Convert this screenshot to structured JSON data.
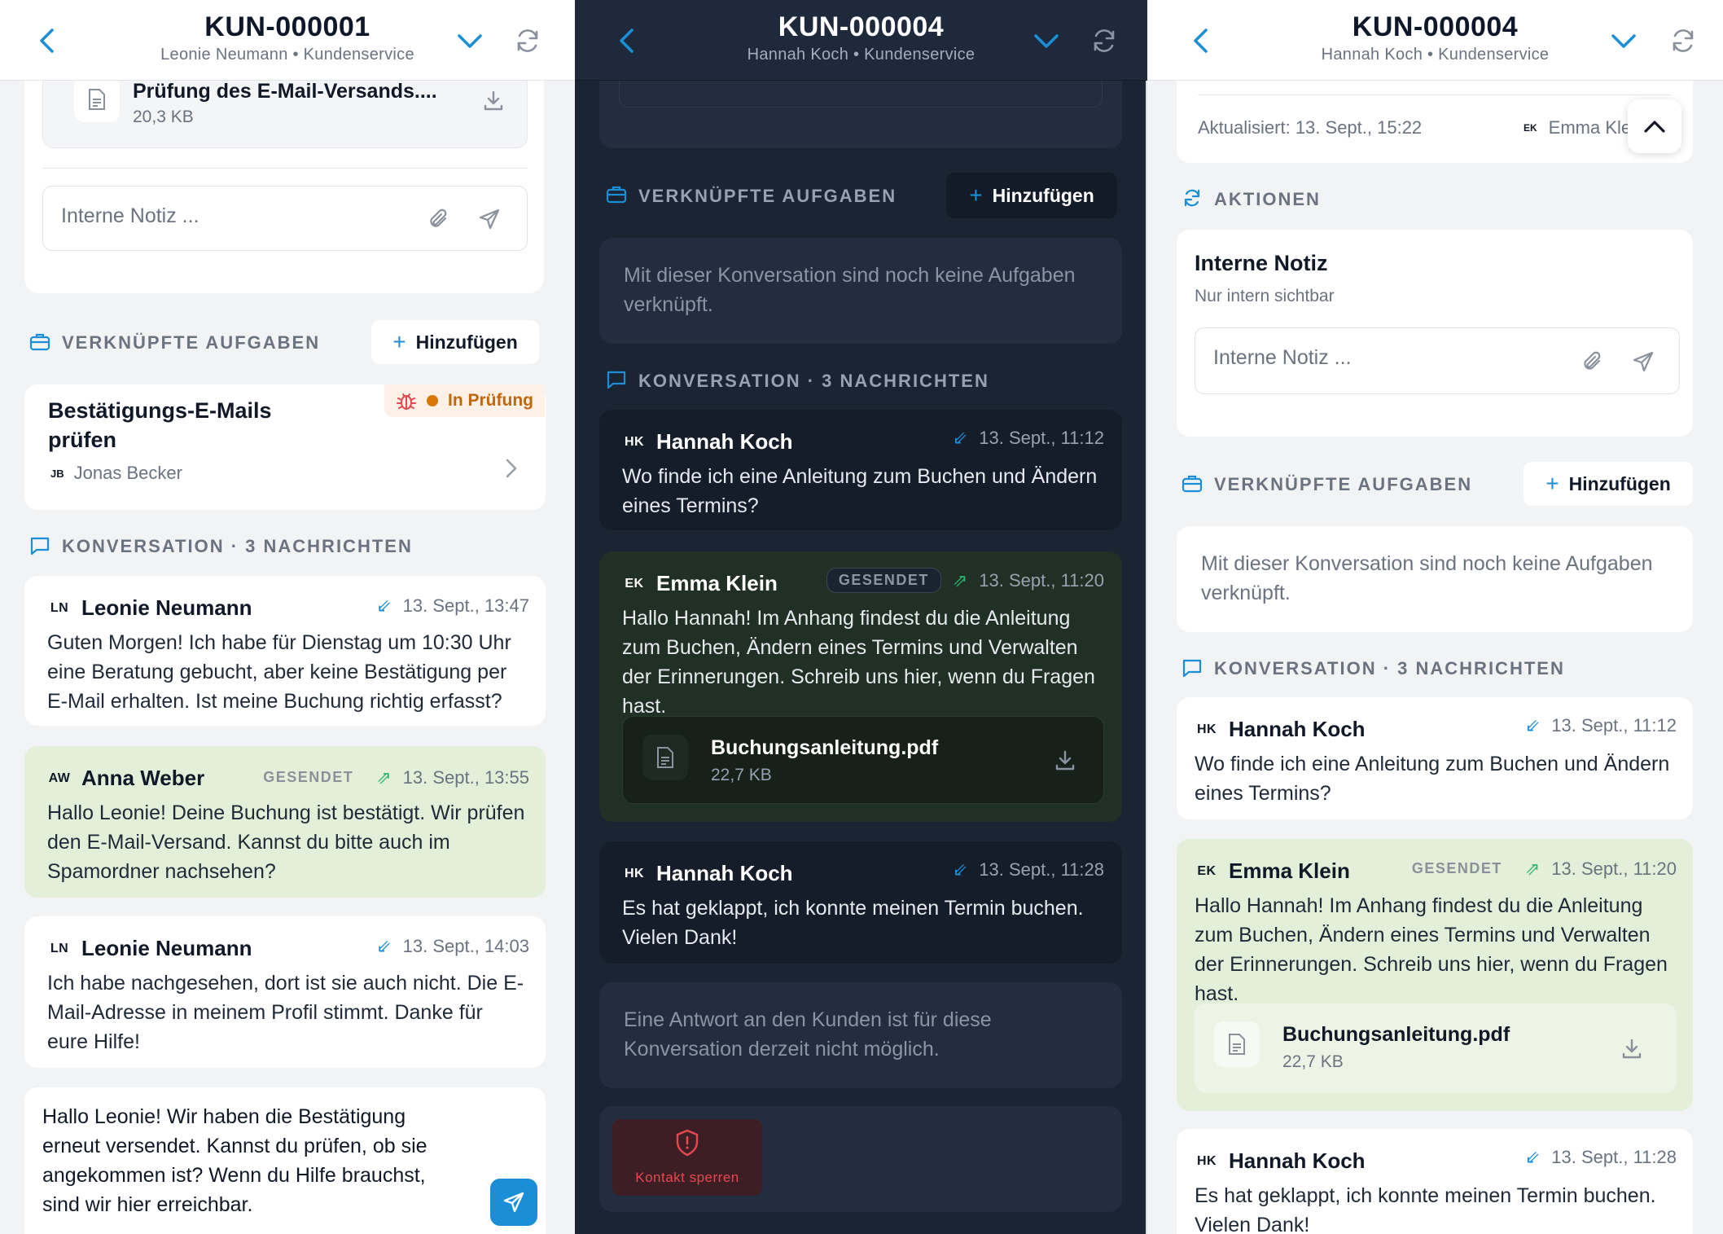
{
  "panel1": {
    "header": {
      "title": "KUN-000001",
      "subtitle": "Leonie Neumann • Kundenservice"
    },
    "attachment": {
      "name": "Prüfung des E-Mail-Versands....",
      "size": "20,3 KB"
    },
    "note_placeholder": "Interne Notiz ...",
    "tasks_section": {
      "label": "VERKNÜPFTE AUFGABEN",
      "add_label": "Hinzufügen"
    },
    "task": {
      "title": "Bestätigungs-E-Mails prüfen",
      "status": "In Prüfung",
      "assignee_initials": "JB",
      "assignee": "Jonas Becker"
    },
    "conversation_section": {
      "label": "KONVERSATION · 3 NACHRICHTEN"
    },
    "messages": [
      {
        "initials": "LN",
        "name": "Leonie Neumann",
        "time": "13. Sept., 13:47",
        "text": "Guten Morgen! Ich habe für Dienstag um 10:30 Uhr eine Beratung gebucht, aber keine Bestätigung per E-Mail erhalten. Ist meine Buchung richtig erfasst?"
      },
      {
        "initials": "AW",
        "name": "Anna Weber",
        "badge": "GESENDET",
        "time": "13. Sept., 13:55",
        "text": "Hallo Leonie! Deine Buchung ist bestätigt. Wir prüfen den E-Mail-Versand. Kannst du bitte auch im Spamordner nachsehen?"
      },
      {
        "initials": "LN",
        "name": "Leonie Neumann",
        "time": "13. Sept., 14:03",
        "text": "Ich habe nachgesehen, dort ist sie auch nicht. Die E-Mail-Adresse in meinem Profil stimmt. Danke für eure Hilfe!"
      }
    ],
    "reply_text": "Hallo Leonie! Wir haben die Bestätigung erneut versendet. Kannst du prüfen, ob sie angekommen ist? Wenn du Hilfe brauchst, sind wir hier erreichbar."
  },
  "panel2": {
    "header": {
      "title": "KUN-000004",
      "subtitle": "Hannah Koch • Kundenservice"
    },
    "tasks_section": {
      "label": "VERKNÜPFTE AUFGABEN",
      "add_label": "Hinzufügen"
    },
    "tasks_empty": "Mit dieser Konversation sind noch keine Aufgaben verknüpft.",
    "conversation_section": {
      "label": "KONVERSATION · 3 NACHRICHTEN"
    },
    "messages": [
      {
        "initials": "HK",
        "name": "Hannah Koch",
        "time": "13. Sept., 11:12",
        "text": "Wo finde ich eine Anleitung zum Buchen und Ändern eines Termins?"
      },
      {
        "initials": "EK",
        "name": "Emma Klein",
        "badge": "GESENDET",
        "time": "13. Sept., 11:20",
        "text": "Hallo Hannah! Im Anhang findest du die Anleitung zum Buchen, Ändern eines Termins und Verwalten der Erinnerungen. Schreib uns hier, wenn du Fragen hast.",
        "attachment": {
          "name": "Buchungsanleitung.pdf",
          "size": "22,7 KB"
        }
      },
      {
        "initials": "HK",
        "name": "Hannah Koch",
        "time": "13. Sept., 11:28",
        "text": "Es hat geklappt, ich konnte meinen Termin buchen. Vielen Dank!"
      }
    ],
    "reply_disabled": "Eine Antwort an den Kunden ist für diese Konversation derzeit nicht möglich.",
    "block_label": "Kontakt sperren"
  },
  "panel3": {
    "header": {
      "title": "KUN-000004",
      "subtitle": "Hannah Koch • Kundenservice"
    },
    "updated": "Aktualisiert: 13. Sept., 15:22",
    "updated_by_initials": "EK",
    "updated_by": "Emma Klein",
    "actions_section": {
      "label": "AKTIONEN"
    },
    "internal_note": {
      "title": "Interne Notiz",
      "subtitle": "Nur intern sichtbar",
      "placeholder": "Interne Notiz ..."
    },
    "tasks_section": {
      "label": "VERKNÜPFTE AUFGABEN",
      "add_label": "Hinzufügen"
    },
    "tasks_empty": "Mit dieser Konversation sind noch keine Aufgaben verknüpft.",
    "conversation_section": {
      "label": "KONVERSATION · 3 NACHRICHTEN"
    },
    "messages": [
      {
        "initials": "HK",
        "name": "Hannah Koch",
        "time": "13. Sept., 11:12",
        "text": "Wo finde ich eine Anleitung zum Buchen und Ändern eines Termins?"
      },
      {
        "initials": "EK",
        "name": "Emma Klein",
        "badge": "GESENDET",
        "time": "13. Sept., 11:20",
        "text": "Hallo Hannah! Im Anhang findest du die Anleitung zum Buchen, Ändern eines Termins und Verwalten der Erinnerungen. Schreib uns hier, wenn du Fragen hast.",
        "attachment": {
          "name": "Buchungsanleitung.pdf",
          "size": "22,7 KB"
        }
      },
      {
        "initials": "HK",
        "name": "Hannah Koch",
        "time": "13. Sept., 11:28",
        "text": "Es hat geklappt, ich konnte meinen Termin buchen. Vielen Dank!"
      }
    ]
  },
  "colors": {
    "accent": "#1a8fd8",
    "sent_bubble_light": "#e3efd8",
    "sent_bubble_dark": "#213024",
    "dark_bg": "#1b2433",
    "status_warning": "#d97706",
    "danger": "#e5484d"
  },
  "icons": [
    "back-chevron-icon",
    "chevron-down-icon",
    "refresh-icon",
    "document-icon",
    "download-icon",
    "paperclip-icon",
    "send-icon",
    "briefcase-icon",
    "chat-icon",
    "bug-icon",
    "chevron-right-icon",
    "incoming-arrow-icon",
    "outgoing-arrow-icon",
    "shield-alert-icon",
    "sync-icon",
    "chevron-up-icon"
  ]
}
